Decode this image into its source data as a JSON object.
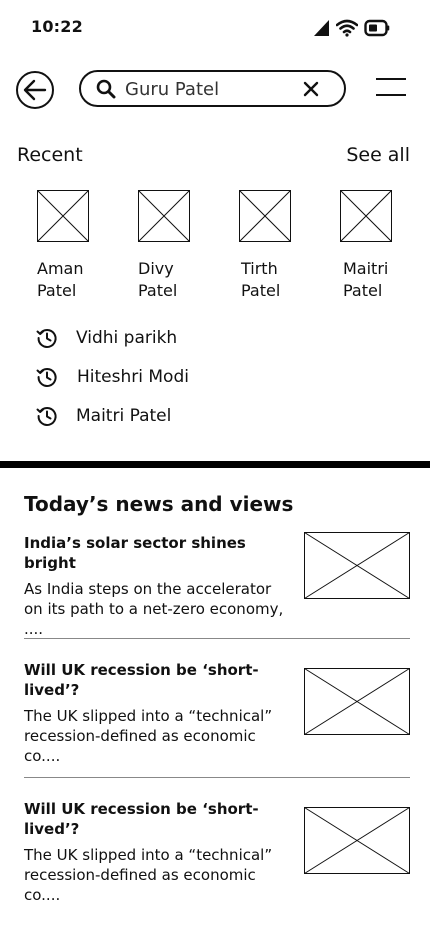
{
  "status_bar": {
    "time": "10:22"
  },
  "search": {
    "value": "Guru Patel"
  },
  "recent": {
    "title": "Recent",
    "see_all_label": "See all",
    "people": [
      {
        "name": "Aman Patel"
      },
      {
        "name": "Divy Patel"
      },
      {
        "name": "Tirth Patel"
      },
      {
        "name": "Maitri Patel"
      }
    ],
    "history": [
      {
        "label": "Vidhi parikh"
      },
      {
        "label": "Hiteshri Modi"
      },
      {
        "label": "Maitri Patel"
      }
    ]
  },
  "news": {
    "title": "Today’s news and views",
    "items": [
      {
        "headline": "India’s solar sector shines bright",
        "summary": "As India steps on the accelerator on its path to a net-zero economy, ...."
      },
      {
        "headline": "Will UK recession be ‘short-lived’?",
        "summary": "The UK slipped into a “technical” recession-defined as economic co...."
      },
      {
        "headline": "Will UK recession be ‘short-lived’?",
        "summary": "The UK slipped into a “technical” recession-defined as economic co...."
      }
    ]
  }
}
